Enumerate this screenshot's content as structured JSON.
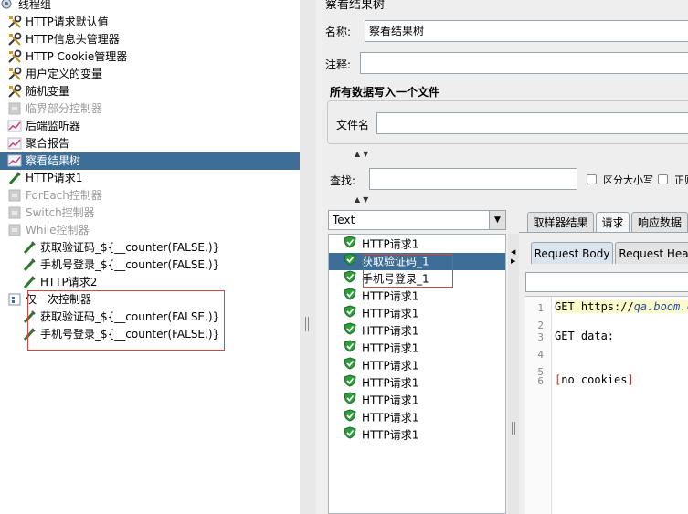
{
  "tree": {
    "root_label": "线程组",
    "items": [
      {
        "label": "HTTP请求默认值",
        "icon": "wrench-icon",
        "disabled": false
      },
      {
        "label": "HTTP信息头管理器",
        "icon": "wrench-icon",
        "disabled": false
      },
      {
        "label": "HTTP Cookie管理器",
        "icon": "wrench-icon",
        "disabled": false
      },
      {
        "label": "用户定义的变量",
        "icon": "wrench-icon",
        "disabled": false
      },
      {
        "label": "随机变量",
        "icon": "wrench-icon",
        "disabled": false
      },
      {
        "label": "临界部分控制器",
        "icon": "controller-icon",
        "disabled": true
      },
      {
        "label": "后端监听器",
        "icon": "chart-icon",
        "disabled": false
      },
      {
        "label": "聚合报告",
        "icon": "chart-icon",
        "disabled": false
      },
      {
        "label": "察看结果树",
        "icon": "chart-icon",
        "disabled": false,
        "selected": true
      },
      {
        "label": "HTTP请求1",
        "icon": "sampler-icon",
        "disabled": false
      },
      {
        "label": "ForEach控制器",
        "icon": "controller-icon",
        "disabled": true
      },
      {
        "label": "Switch控制器",
        "icon": "controller-icon",
        "disabled": true
      },
      {
        "label": "While控制器",
        "icon": "controller-icon",
        "disabled": true
      },
      {
        "label": "获取验证码_${__counter(FALSE,)}",
        "icon": "sampler-icon",
        "disabled": false
      },
      {
        "label": "手机号登录_${__counter(FALSE,)}",
        "icon": "sampler-icon",
        "disabled": false
      },
      {
        "label": "HTTP请求2",
        "icon": "sampler-icon",
        "disabled": false
      },
      {
        "label": "仅一次控制器",
        "icon": "once-controller-icon",
        "disabled": false
      },
      {
        "label": "获取验证码_${__counter(FALSE,)}",
        "icon": "sampler-icon",
        "disabled": false
      },
      {
        "label": "手机号登录_${__counter(FALSE,)}",
        "icon": "sampler-icon",
        "disabled": false
      }
    ]
  },
  "panel": {
    "title": "察看结果树",
    "name_label": "名称:",
    "name_value": "察看结果树",
    "comment_label": "注释:",
    "comment_value": "",
    "file_section_title": "所有数据写入一个文件",
    "file_label": "文件名",
    "file_value": "",
    "search_label": "查找:",
    "search_value": "",
    "case_label": "区分大小写",
    "regex_label": "正则"
  },
  "renderer": {
    "selected": "Text"
  },
  "results": [
    "HTTP请求1",
    "获取验证码_1",
    "手机号登录_1",
    "HTTP请求1",
    "HTTP请求1",
    "HTTP请求1",
    "HTTP请求1",
    "HTTP请求1",
    "HTTP请求1",
    "HTTP请求1",
    "HTTP请求1",
    "HTTP请求1"
  ],
  "tabs": [
    "取样器结果",
    "请求",
    "响应数据"
  ],
  "subtabs": [
    "Request Body",
    "Request Hea"
  ],
  "viewer": {
    "line_numbers": [
      "1",
      "2",
      "3",
      "4",
      "5",
      "6"
    ],
    "line1_prefix": "GET https://",
    "line1_url": "qa.boom.c",
    "line3": "GET data:",
    "line6": "[no cookies]"
  },
  "colors": {
    "selection": "#3c6e97",
    "annotation_red": "#d9443f",
    "ok_green": "#2e9e3a"
  }
}
